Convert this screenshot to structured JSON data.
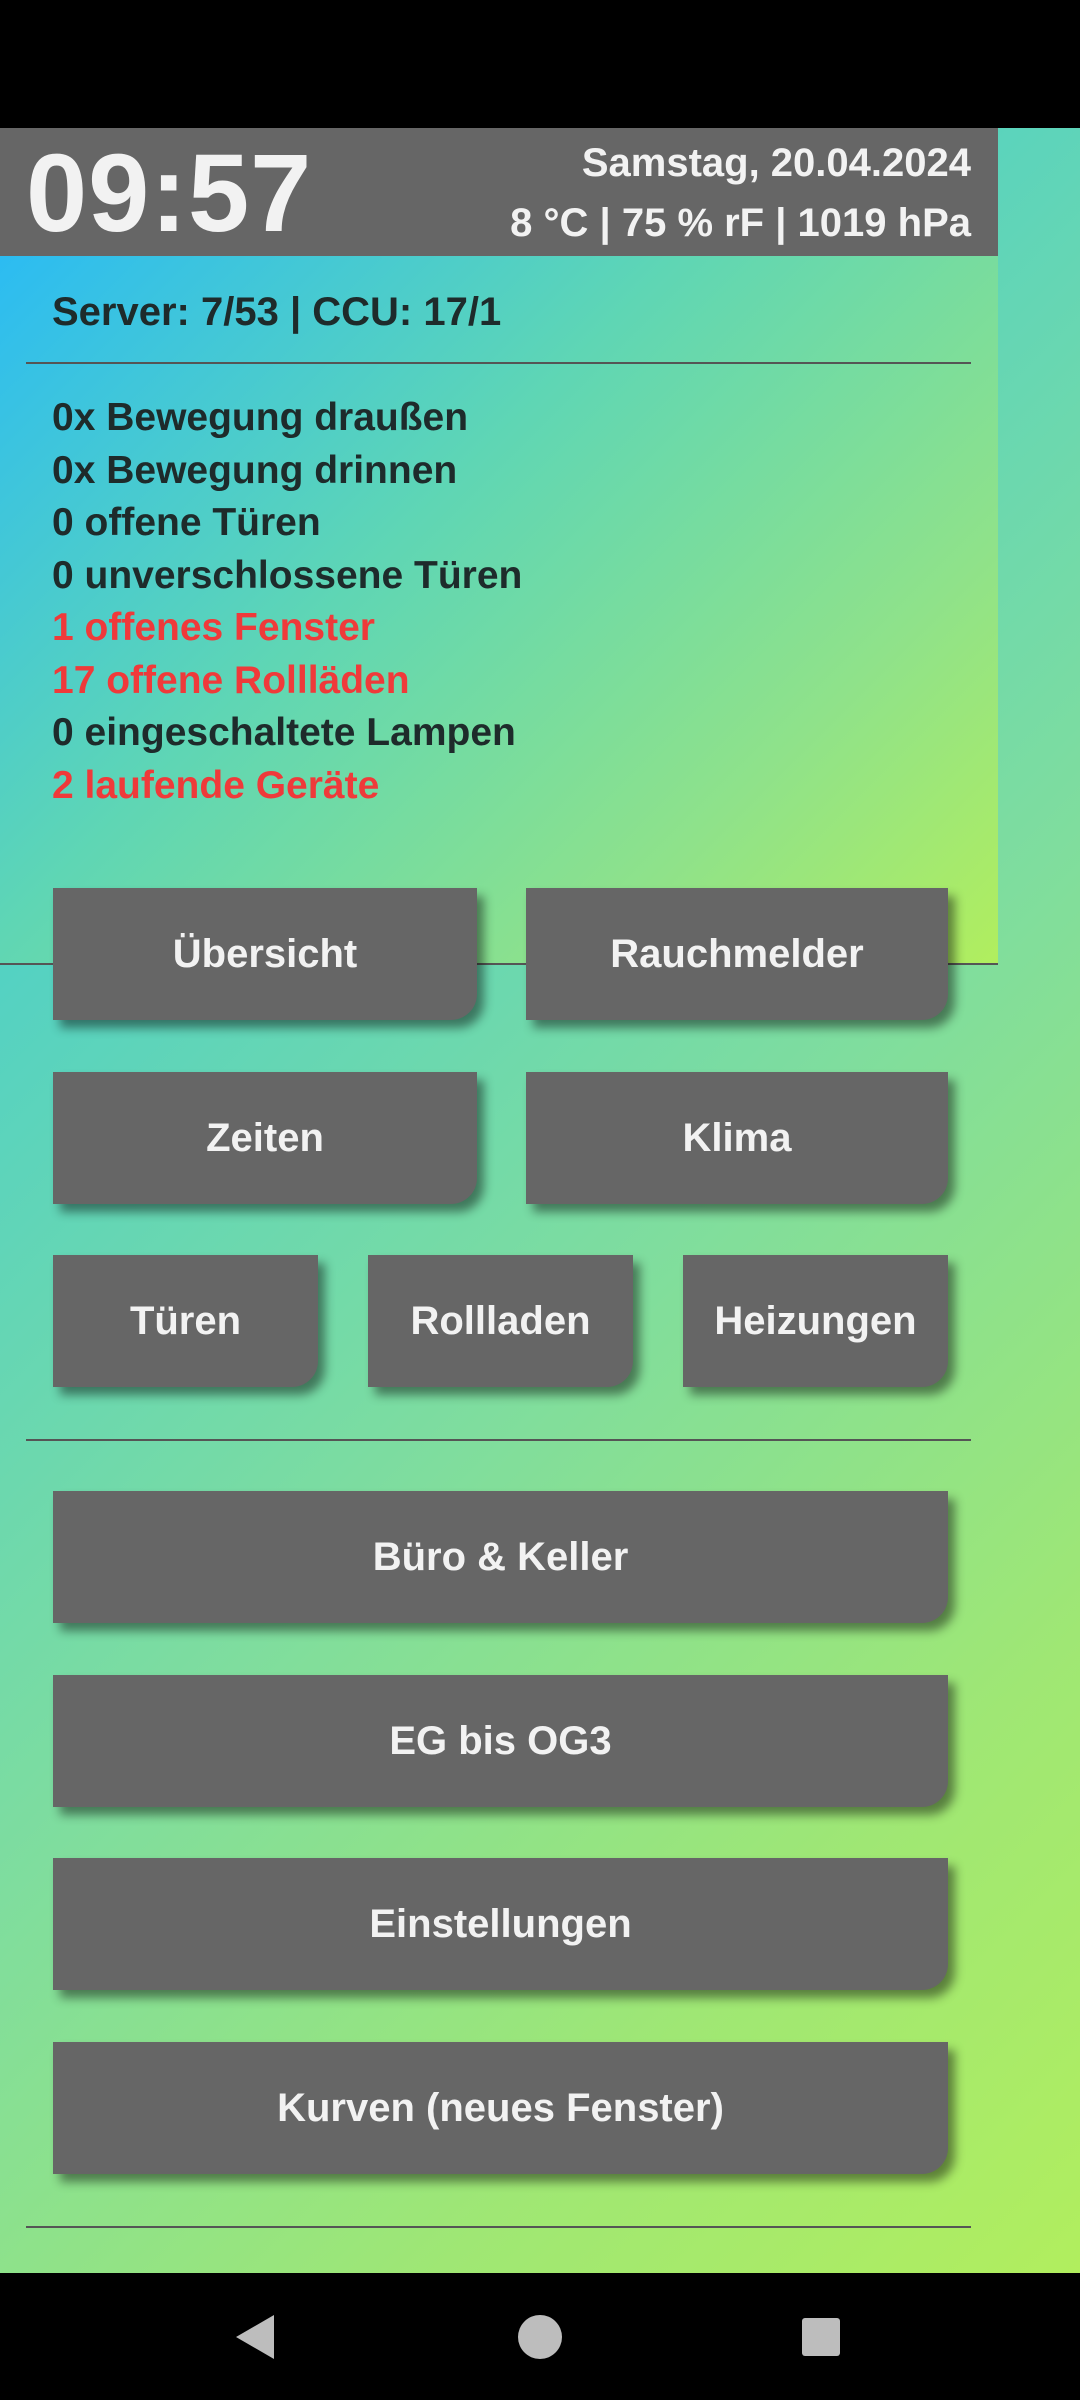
{
  "header": {
    "time": "09:57",
    "date": "Samstag, 20.04.2024",
    "weather": "8 °C | 75 % rF | 1019 hPa"
  },
  "server_status": "Server: 7/53 | CCU: 17/1",
  "status_items": [
    {
      "text": "0x Bewegung draußen",
      "alert": false
    },
    {
      "text": "0x Bewegung drinnen",
      "alert": false
    },
    {
      "text": "0 offene Türen",
      "alert": false
    },
    {
      "text": "0 unverschlossene Türen",
      "alert": false
    },
    {
      "text": "1 offenes Fenster",
      "alert": true
    },
    {
      "text": "17 offene Rollläden",
      "alert": true
    },
    {
      "text": "0 eingeschaltete Lampen",
      "alert": false
    },
    {
      "text": "2 laufende Geräte",
      "alert": true
    }
  ],
  "buttons": {
    "overview": "Übersicht",
    "smoke_detectors": "Rauchmelder",
    "times": "Zeiten",
    "climate": "Klima",
    "doors": "Türen",
    "shutters": "Rollladen",
    "heating": "Heizungen",
    "office_basement": "Büro & Keller",
    "floors": "EG bis OG3",
    "settings": "Einstellungen",
    "curves": "Kurven (neues Fenster)"
  },
  "colors": {
    "alert": "#ef3a3a",
    "normal_text": "#1e2b2b",
    "button_bg": "#666666",
    "header_bg": "#666666"
  },
  "system_nav": [
    "back-icon",
    "home-icon",
    "recents-icon"
  ]
}
